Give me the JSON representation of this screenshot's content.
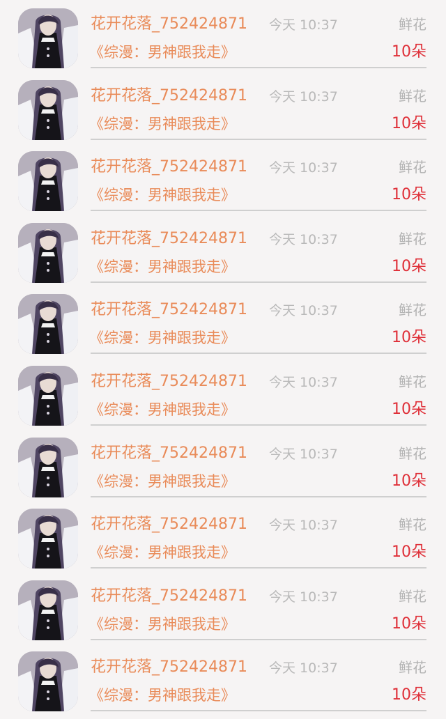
{
  "gift_list": [
    {
      "user": "花开花落_752424871",
      "time": "今天 10:37",
      "gift_type": "鲜花",
      "book": "《综漫：男神跟我走》",
      "amount": "10朵"
    },
    {
      "user": "花开花落_752424871",
      "time": "今天 10:37",
      "gift_type": "鲜花",
      "book": "《综漫：男神跟我走》",
      "amount": "10朵"
    },
    {
      "user": "花开花落_752424871",
      "time": "今天 10:37",
      "gift_type": "鲜花",
      "book": "《综漫：男神跟我走》",
      "amount": "10朵"
    },
    {
      "user": "花开花落_752424871",
      "time": "今天 10:37",
      "gift_type": "鲜花",
      "book": "《综漫：男神跟我走》",
      "amount": "10朵"
    },
    {
      "user": "花开花落_752424871",
      "time": "今天 10:37",
      "gift_type": "鲜花",
      "book": "《综漫：男神跟我走》",
      "amount": "10朵"
    },
    {
      "user": "花开花落_752424871",
      "time": "今天 10:37",
      "gift_type": "鲜花",
      "book": "《综漫：男神跟我走》",
      "amount": "10朵"
    },
    {
      "user": "花开花落_752424871",
      "time": "今天 10:37",
      "gift_type": "鲜花",
      "book": "《综漫：男神跟我走》",
      "amount": "10朵"
    },
    {
      "user": "花开花落_752424871",
      "time": "今天 10:37",
      "gift_type": "鲜花",
      "book": "《综漫：男神跟我走》",
      "amount": "10朵"
    },
    {
      "user": "花开花落_752424871",
      "time": "今天 10:37",
      "gift_type": "鲜花",
      "book": "《综漫：男神跟我走》",
      "amount": "10朵"
    },
    {
      "user": "花开花落_752424871",
      "time": "今天 10:37",
      "gift_type": "鲜花",
      "book": "《综漫：男神跟我走》",
      "amount": "10朵"
    }
  ],
  "colors": {
    "background": "#f6f4f4",
    "username": "#e98b59",
    "book_title": "#e98b59",
    "meta_text": "#b9b9b9",
    "amount": "#df2f38",
    "divider": "#cfcfcf"
  },
  "icons": {
    "avatar": "user-avatar-anime-character"
  }
}
